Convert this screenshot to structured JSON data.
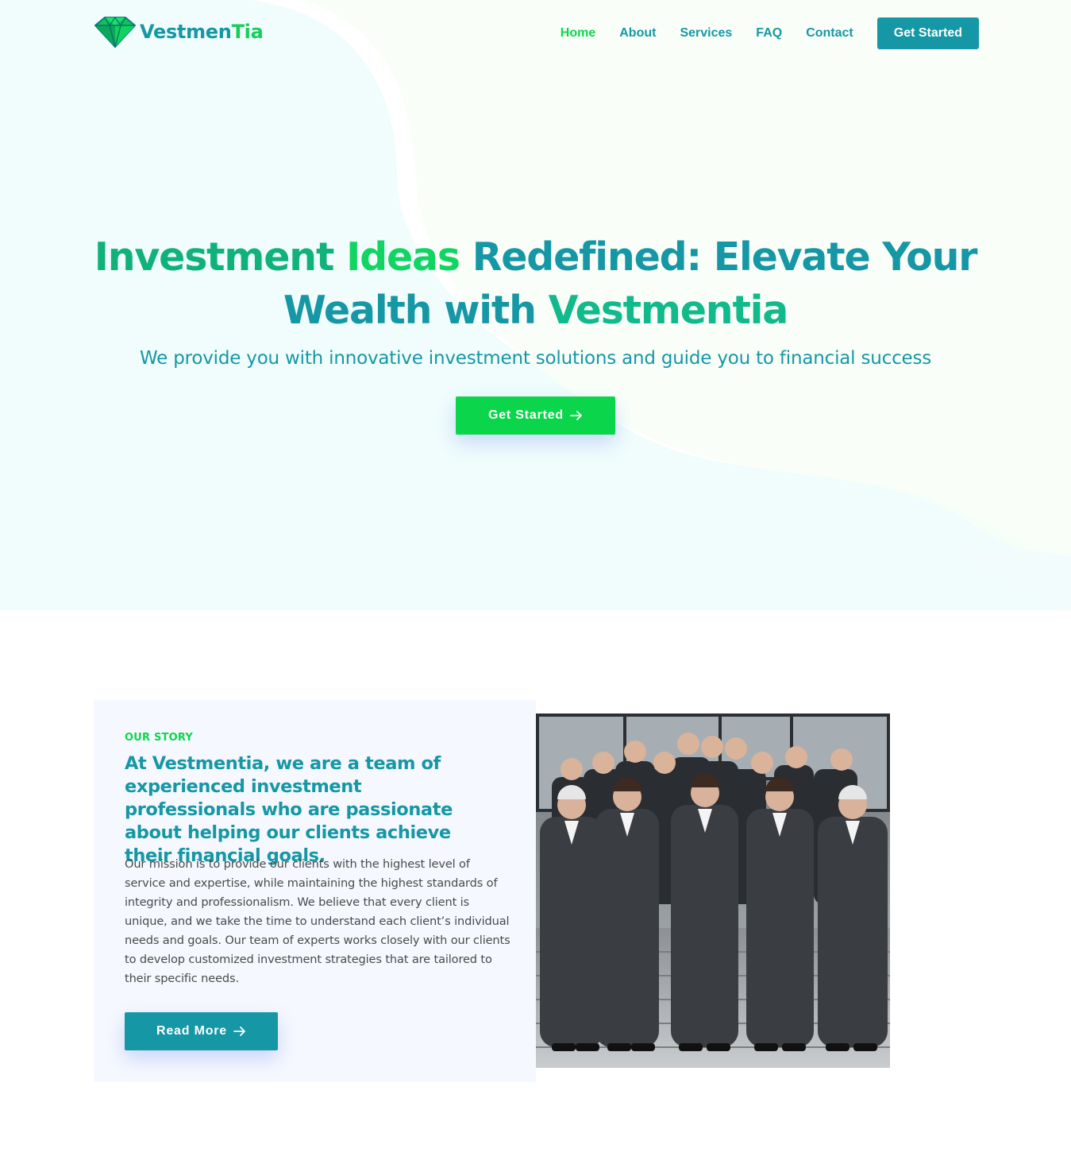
{
  "brand": {
    "name_part1": "Vestmen",
    "name_part2": "Tia",
    "logo_icon": "diamond-icon"
  },
  "nav": {
    "links": [
      {
        "label": "Home",
        "active": true
      },
      {
        "label": "About",
        "active": false
      },
      {
        "label": "Services",
        "active": false
      },
      {
        "label": "FAQ",
        "active": false
      },
      {
        "label": "Contact",
        "active": false
      }
    ],
    "cta_label": "Get Started"
  },
  "hero": {
    "title_part1": "Investment ",
    "title_part2": "Ideas",
    "title_part3": " Redefined: Elevate Your",
    "title_part4": "Wealth with ",
    "title_part5": "Vestmentia",
    "subtitle": "We provide you with innovative investment solutions and guide you to financial success",
    "cta_label": "Get Started",
    "cta_icon": "arrow-right-icon"
  },
  "story": {
    "label": "OUR STORY",
    "heading": "At Vestmentia, we are a team of experienced investment professionals who are passionate about helping our clients achieve their financial goals.",
    "body": "Our mission is to provide our clients with the highest level of service and expertise, while maintaining the highest standards of integrity and professionalism. We believe that every client is unique, and we take the time to understand each client’s individual needs and goals. Our team of experts works closely with our clients to develop customized investment strategies that are tailored to their specific needs.",
    "button_label": "Read More",
    "button_icon": "arrow-right-icon",
    "image": "team-photo"
  },
  "colors": {
    "primary": "#1597a5",
    "accent": "#0bd64b",
    "hero_bg": "#f0fdfc",
    "card_bg": "#f5f8fe",
    "body_text": "#4a4a4a"
  }
}
